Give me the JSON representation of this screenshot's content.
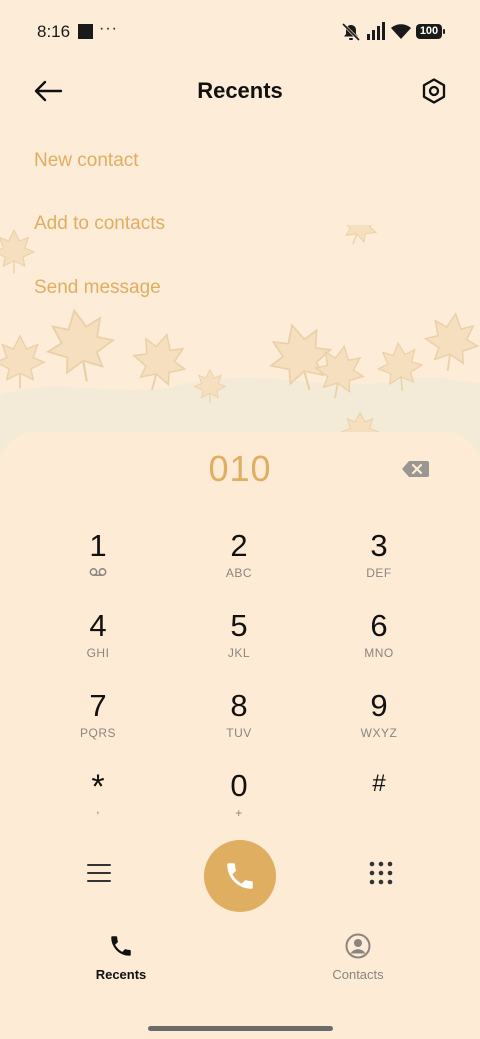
{
  "status_bar": {
    "time": "8:16",
    "more": "···",
    "battery": "100"
  },
  "header": {
    "title": "Recents"
  },
  "actions": {
    "new_contact": "New contact",
    "add_to_contacts": "Add to contacts",
    "send_message": "Send message"
  },
  "dialer": {
    "number": "010",
    "keys": [
      {
        "digit": "1",
        "letters": ""
      },
      {
        "digit": "2",
        "letters": "ABC"
      },
      {
        "digit": "3",
        "letters": "DEF"
      },
      {
        "digit": "4",
        "letters": "GHI"
      },
      {
        "digit": "5",
        "letters": "JKL"
      },
      {
        "digit": "6",
        "letters": "MNO"
      },
      {
        "digit": "7",
        "letters": "PQRS"
      },
      {
        "digit": "8",
        "letters": "TUV"
      },
      {
        "digit": "9",
        "letters": "WXYZ"
      },
      {
        "digit": "*",
        "letters": ","
      },
      {
        "digit": "0",
        "letters": "+"
      },
      {
        "digit": "#",
        "letters": ""
      }
    ]
  },
  "bottom_nav": {
    "recents": "Recents",
    "contacts": "Contacts"
  },
  "colors": {
    "accent": "#dfae61",
    "background": "#fcecd8"
  }
}
